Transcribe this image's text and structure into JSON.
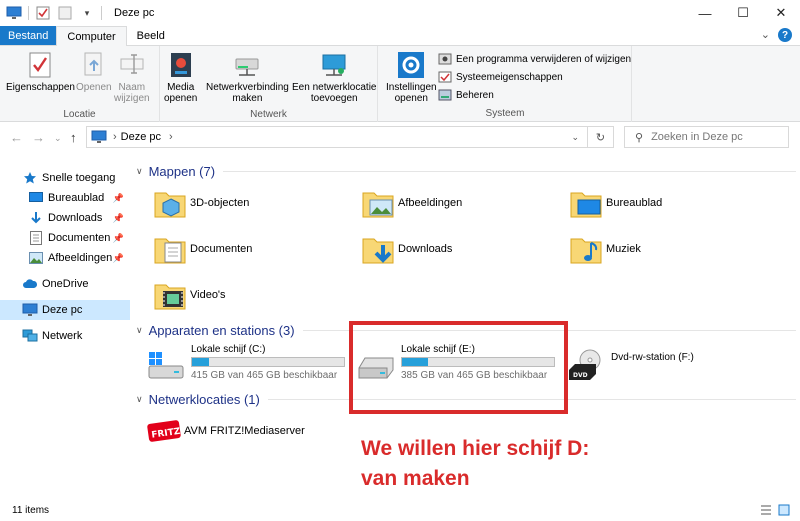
{
  "window": {
    "title": "Deze pc",
    "minimize": "—",
    "maximize": "☐",
    "close": "✕"
  },
  "ribbon_tabs": [
    "Bestand",
    "Computer",
    "Beeld"
  ],
  "ribbon": {
    "locatie": {
      "label": "Locatie",
      "eigenschappen": "Eigenschappen",
      "openen": "Openen",
      "naam_wijzigen_1": "Naam",
      "naam_wijzigen_2": "wijzigen"
    },
    "netwerk": {
      "label": "Netwerk",
      "media_1": "Media",
      "media_2": "openen",
      "netwerkverbinding_1": "Netwerkverbinding",
      "netwerkverbinding_2": "maken",
      "netwerklocatie_1": "Een netwerklocatie",
      "netwerklocatie_2": "toevoegen"
    },
    "systeem": {
      "label": "Systeem",
      "instellingen_1": "Instellingen",
      "instellingen_2": "openen",
      "verwijderen": "Een programma verwijderen of wijzigen",
      "systeemeigenschappen": "Systeemeigenschappen",
      "beheren": "Beheren"
    }
  },
  "address": {
    "path": "Deze pc",
    "search_placeholder": "Zoeken in Deze pc"
  },
  "nav": {
    "snelle_toegang": "Snelle toegang",
    "bureaublad": "Bureaublad",
    "downloads": "Downloads",
    "documenten": "Documenten",
    "afbeeldingen": "Afbeeldingen",
    "onedrive": "OneDrive",
    "deze_pc": "Deze pc",
    "netwerk": "Netwerk"
  },
  "sections": {
    "mappen": "Mappen (7)",
    "apparaten": "Apparaten en stations (3)",
    "netwerklocaties": "Netwerklocaties (1)"
  },
  "folders": [
    "3D-objecten",
    "Afbeeldingen",
    "Bureaublad",
    "Documenten",
    "Downloads",
    "Muziek",
    "Video's"
  ],
  "drives": [
    {
      "name": "Lokale schijf (C:)",
      "free": "415 GB van 465 GB beschikbaar",
      "used_fraction": 0.11
    },
    {
      "name": "Lokale schijf (E:)",
      "free": "385 GB van 465 GB beschikbaar",
      "used_fraction": 0.17
    },
    {
      "name": "Dvd-rw-station (F:)"
    }
  ],
  "network_location": "AVM FRITZ!Mediaserver",
  "annotation": {
    "line1": "We willen hier schijf D:",
    "line2": "van maken",
    "color": "#d92b2b"
  },
  "status": {
    "items": "11 items"
  },
  "colors": {
    "accent": "#1979ca",
    "drive_fill": "#26a0da",
    "section_header": "#1e3287",
    "selection": "#cce8ff"
  }
}
